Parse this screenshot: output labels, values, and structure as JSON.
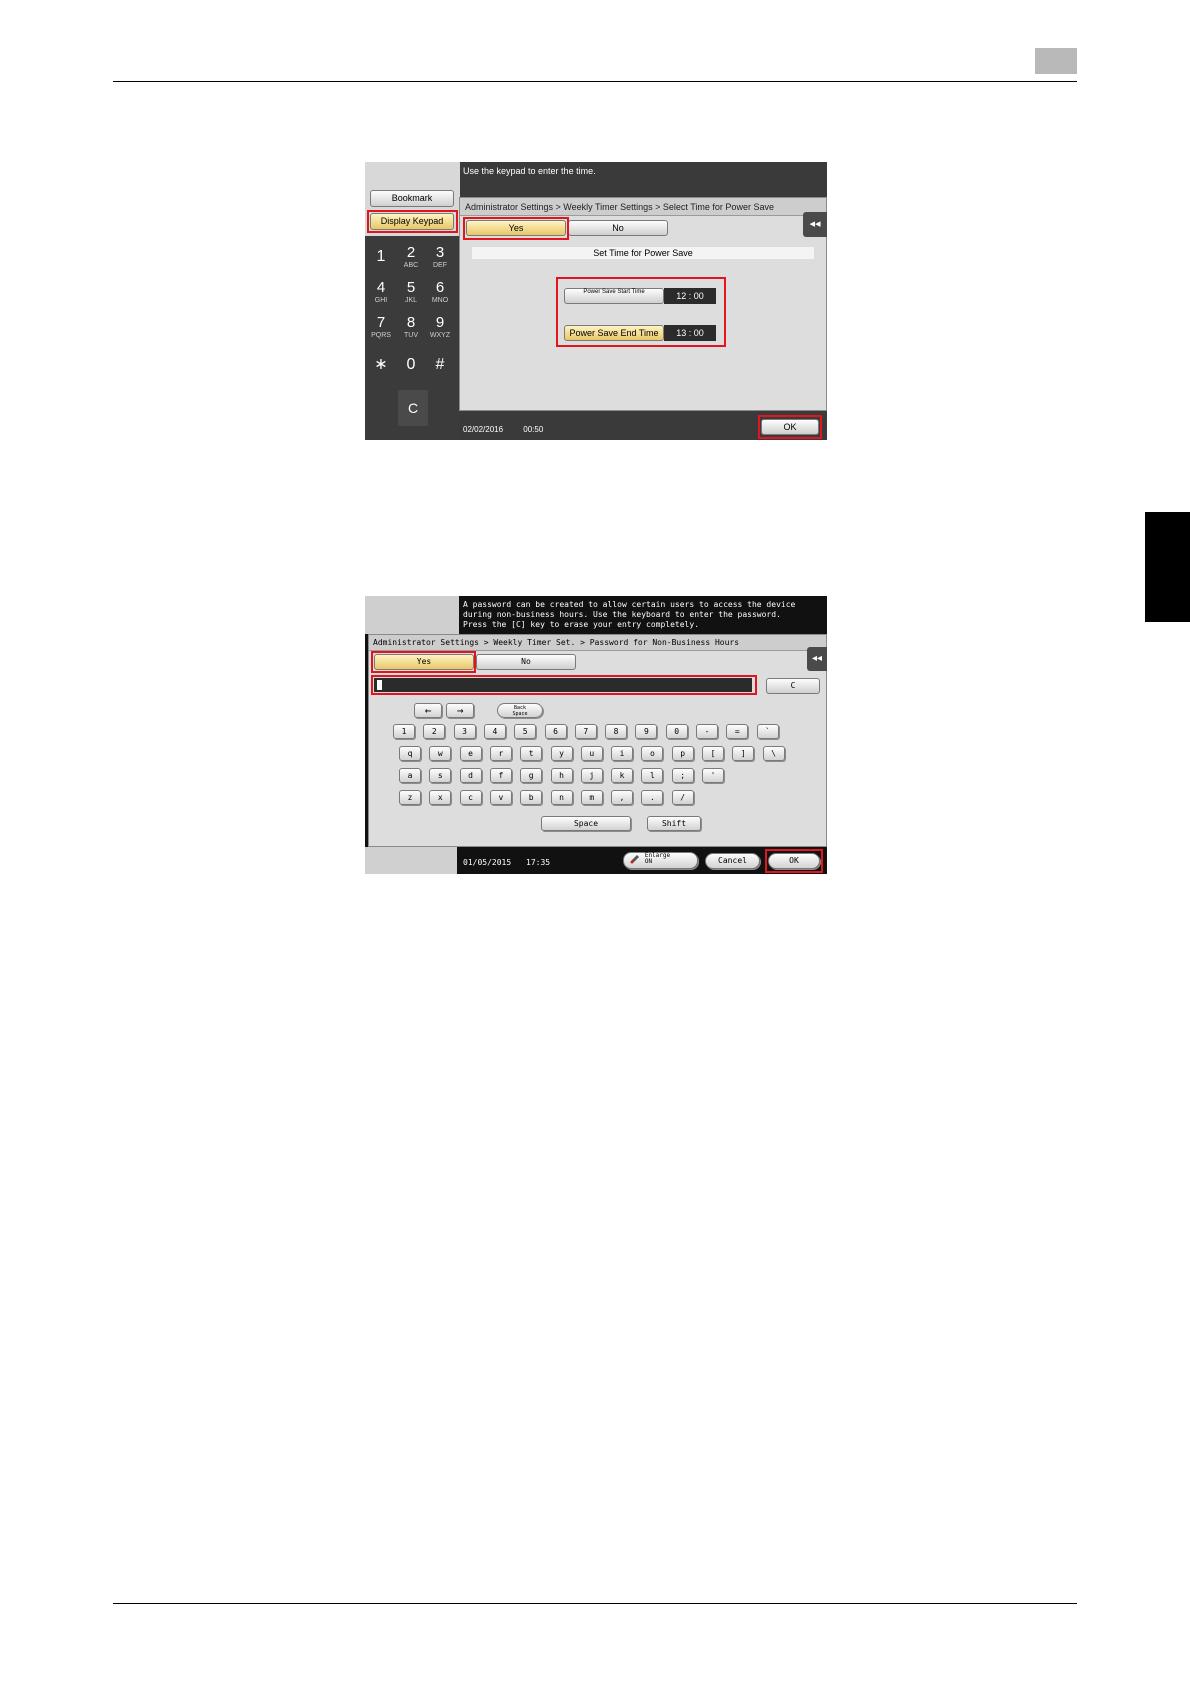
{
  "screen1": {
    "message": "Use the keypad to enter the time.",
    "bookmark_label": "Bookmark",
    "display_keypad_label": "Display Keypad",
    "keypad": [
      {
        "num": "1",
        "sub": ""
      },
      {
        "num": "2",
        "sub": "ABC"
      },
      {
        "num": "3",
        "sub": "DEF"
      },
      {
        "num": "4",
        "sub": "GHI"
      },
      {
        "num": "5",
        "sub": "JKL"
      },
      {
        "num": "6",
        "sub": "MNO"
      },
      {
        "num": "7",
        "sub": "PQRS"
      },
      {
        "num": "8",
        "sub": "TUV"
      },
      {
        "num": "9",
        "sub": "WXYZ"
      },
      {
        "num": "∗",
        "sub": ""
      },
      {
        "num": "0",
        "sub": ""
      },
      {
        "num": "#",
        "sub": ""
      }
    ],
    "clear_label": "C",
    "breadcrumb": "Administrator Settings > Weekly Timer Settings > Select Time for Power Save",
    "yes_label": "Yes",
    "no_label": "No",
    "subheading": "Set Time for Power Save",
    "start_label": "Power Save Start Time",
    "start_time": "12 : 00",
    "end_label": "Power Save End Time",
    "end_time": "13 : 00",
    "date": "02/02/2016",
    "time": "00:50",
    "ok_label": "OK",
    "collapse_icon": "◂◂"
  },
  "screen2": {
    "message": "A password can be created to allow certain users to access the device\nduring non-business hours. Use the keyboard to enter the password.\nPress the [C] key to erase your entry completely.",
    "breadcrumb": "Administrator Settings > Weekly Timer Set. > Password for Non-Business Hours",
    "yes_label": "Yes",
    "no_label": "No",
    "clear_label": "C",
    "left_arrow": "←",
    "right_arrow": "→",
    "backspace_label": "Back\nSpace",
    "row1": [
      "1",
      "2",
      "3",
      "4",
      "5",
      "6",
      "7",
      "8",
      "9",
      "0",
      "-",
      "=",
      "`"
    ],
    "row2": [
      "q",
      "w",
      "e",
      "r",
      "t",
      "y",
      "u",
      "i",
      "o",
      "p",
      "[",
      "]",
      "\\"
    ],
    "row3": [
      "a",
      "s",
      "d",
      "f",
      "g",
      "h",
      "j",
      "k",
      "l",
      ";",
      "'"
    ],
    "row4": [
      "z",
      "x",
      "c",
      "v",
      "b",
      "n",
      "m",
      ",",
      ".",
      "/"
    ],
    "space_label": "Space",
    "shift_label": "Shift",
    "date": "01/05/2015",
    "time": "17:35",
    "enlarge_label": "Enlarge\nON",
    "cancel_label": "Cancel",
    "ok_label": "OK",
    "collapse_icon": "◂◂"
  }
}
